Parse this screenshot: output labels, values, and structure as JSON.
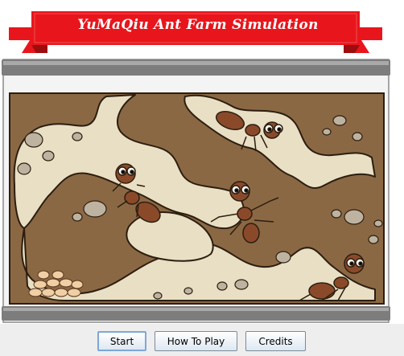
{
  "window": {
    "banner_title": "YuMaQiu Ant Farm Simulation"
  },
  "toolbar": {
    "start_label": "Start",
    "how_to_play_label": "How To Play",
    "credits_label": "Credits"
  },
  "colors": {
    "banner_red": "#e8161c",
    "banner_dark_red": "#a30f12",
    "soil": "#8b6844",
    "tunnel": "#e9dfc4",
    "frame": "#6f6f6f",
    "ant_body": "#8a4a2a"
  },
  "scene": {
    "ant_count": 5,
    "egg_count": 10
  }
}
